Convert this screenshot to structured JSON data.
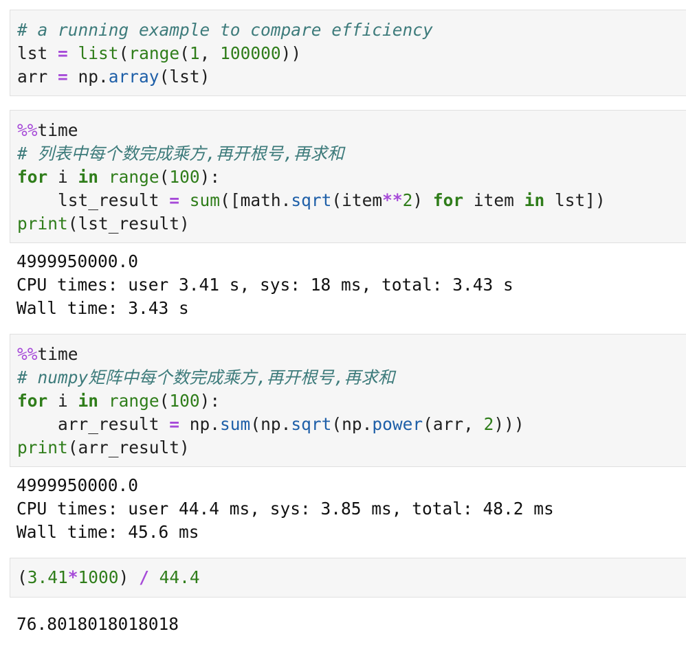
{
  "cells": [
    {
      "lines": [
        [
          {
            "t": "comment",
            "v": "# a running example to compare efficiency"
          }
        ],
        [
          {
            "t": "plain",
            "v": "lst "
          },
          {
            "t": "op",
            "v": "="
          },
          {
            "t": "plain",
            "v": " "
          },
          {
            "t": "bi",
            "v": "list"
          },
          {
            "t": "plain",
            "v": "("
          },
          {
            "t": "bi",
            "v": "range"
          },
          {
            "t": "plain",
            "v": "("
          },
          {
            "t": "num",
            "v": "1"
          },
          {
            "t": "plain",
            "v": ", "
          },
          {
            "t": "num",
            "v": "100000"
          },
          {
            "t": "plain",
            "v": "))"
          }
        ],
        [
          {
            "t": "plain",
            "v": "arr "
          },
          {
            "t": "op",
            "v": "="
          },
          {
            "t": "plain",
            "v": " np."
          },
          {
            "t": "fn",
            "v": "array"
          },
          {
            "t": "plain",
            "v": "(lst)"
          }
        ]
      ],
      "output": []
    },
    {
      "lines": [
        [
          {
            "t": "magic",
            "v": "%%"
          },
          {
            "t": "plain",
            "v": "time"
          }
        ],
        [
          {
            "t": "comment",
            "v": "# 列表中每个数完成乘方,再开根号,再求和"
          }
        ],
        [
          {
            "t": "kw",
            "v": "for"
          },
          {
            "t": "plain",
            "v": " i "
          },
          {
            "t": "kw",
            "v": "in"
          },
          {
            "t": "plain",
            "v": " "
          },
          {
            "t": "bi",
            "v": "range"
          },
          {
            "t": "plain",
            "v": "("
          },
          {
            "t": "num",
            "v": "100"
          },
          {
            "t": "plain",
            "v": "):"
          }
        ],
        [
          {
            "t": "plain",
            "v": "    lst_result "
          },
          {
            "t": "op",
            "v": "="
          },
          {
            "t": "plain",
            "v": " "
          },
          {
            "t": "bi",
            "v": "sum"
          },
          {
            "t": "plain",
            "v": "([math."
          },
          {
            "t": "fn",
            "v": "sqrt"
          },
          {
            "t": "plain",
            "v": "(item"
          },
          {
            "t": "op",
            "v": "**"
          },
          {
            "t": "num",
            "v": "2"
          },
          {
            "t": "plain",
            "v": ") "
          },
          {
            "t": "kw",
            "v": "for"
          },
          {
            "t": "plain",
            "v": " item "
          },
          {
            "t": "kw",
            "v": "in"
          },
          {
            "t": "plain",
            "v": " lst])"
          }
        ],
        [
          {
            "t": "bi",
            "v": "print"
          },
          {
            "t": "plain",
            "v": "(lst_result)"
          }
        ]
      ],
      "output": [
        "4999950000.0",
        "CPU times: user 3.41 s, sys: 18 ms, total: 3.43 s",
        "Wall time: 3.43 s"
      ]
    },
    {
      "lines": [
        [
          {
            "t": "magic",
            "v": "%%"
          },
          {
            "t": "plain",
            "v": "time"
          }
        ],
        [
          {
            "t": "comment",
            "v": "# numpy矩阵中每个数完成乘方,再开根号,再求和"
          }
        ],
        [
          {
            "t": "kw",
            "v": "for"
          },
          {
            "t": "plain",
            "v": " i "
          },
          {
            "t": "kw",
            "v": "in"
          },
          {
            "t": "plain",
            "v": " "
          },
          {
            "t": "bi",
            "v": "range"
          },
          {
            "t": "plain",
            "v": "("
          },
          {
            "t": "num",
            "v": "100"
          },
          {
            "t": "plain",
            "v": "):"
          }
        ],
        [
          {
            "t": "plain",
            "v": "    arr_result "
          },
          {
            "t": "op",
            "v": "="
          },
          {
            "t": "plain",
            "v": " np."
          },
          {
            "t": "fn",
            "v": "sum"
          },
          {
            "t": "plain",
            "v": "(np."
          },
          {
            "t": "fn",
            "v": "sqrt"
          },
          {
            "t": "plain",
            "v": "(np."
          },
          {
            "t": "fn",
            "v": "power"
          },
          {
            "t": "plain",
            "v": "(arr, "
          },
          {
            "t": "num",
            "v": "2"
          },
          {
            "t": "plain",
            "v": ")))"
          }
        ],
        [
          {
            "t": "bi",
            "v": "print"
          },
          {
            "t": "plain",
            "v": "(arr_result)"
          }
        ]
      ],
      "output": [
        "4999950000.0",
        "CPU times: user 44.4 ms, sys: 3.85 ms, total: 48.2 ms",
        "Wall time: 45.6 ms"
      ]
    },
    {
      "lines": [
        [
          {
            "t": "plain",
            "v": "("
          },
          {
            "t": "num",
            "v": "3.41"
          },
          {
            "t": "op",
            "v": "*"
          },
          {
            "t": "num",
            "v": "1000"
          },
          {
            "t": "plain",
            "v": ") "
          },
          {
            "t": "op",
            "v": "/"
          },
          {
            "t": "plain",
            "v": " "
          },
          {
            "t": "num",
            "v": "44.4"
          }
        ]
      ],
      "output": [
        "76.8018018018018"
      ]
    }
  ]
}
